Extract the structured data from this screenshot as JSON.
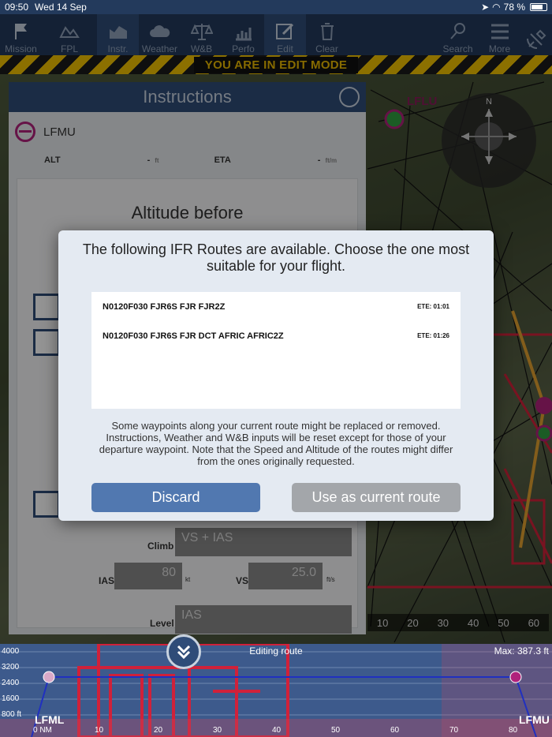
{
  "status": {
    "time": "09:50",
    "date": "Wed 14 Sep",
    "battery": "78 %",
    "battery_level": 0.78
  },
  "toolbar": {
    "items": [
      {
        "label": "Mission",
        "icon": "flag-icon"
      },
      {
        "label": "FPL",
        "icon": "map-icon"
      },
      {
        "label": "Instr.",
        "icon": "chart-area-icon"
      },
      {
        "label": "Weather",
        "icon": "cloud-icon"
      },
      {
        "label": "W&B",
        "icon": "scales-icon"
      },
      {
        "label": "Perfo",
        "icon": "bar-chart-icon"
      },
      {
        "label": "Edit",
        "icon": "edit-icon"
      },
      {
        "label": "Clear",
        "icon": "trash-icon"
      },
      {
        "label": "Search",
        "icon": "search-icon"
      },
      {
        "label": "More",
        "icon": "menu-icon"
      }
    ]
  },
  "banner": {
    "text": "YOU ARE IN EDIT MODE"
  },
  "instructions": {
    "title": "Instructions",
    "waypoint": "LFMU",
    "alt_label": "ALT",
    "alt_value": "-",
    "alt_unit": "ft",
    "eta_label": "ETA",
    "eta_value": "-",
    "eta_unit": "ft/m",
    "altitude_before": "Altitude before",
    "climb_label": "Climb",
    "climb_value": "VS + IAS",
    "ias_label": "IAS",
    "ias_value": "80",
    "ias_unit": "kt",
    "vs_label": "VS",
    "vs_value": "25.0",
    "vs_unit": "ft/s",
    "level_label": "Level",
    "level_value": "IAS"
  },
  "map": {
    "labels": [
      "LFLU"
    ],
    "scale": [
      "10",
      "20",
      "30",
      "40",
      "50",
      "60"
    ]
  },
  "profile": {
    "title": "Editing route",
    "max": "Max: 387.3 ft",
    "y_labels": [
      "4000",
      "3200",
      "2400",
      "1600",
      "800 ft"
    ],
    "start": "LFML",
    "end": "LFMU",
    "distance_ticks": [
      "0 NM",
      "10",
      "20",
      "30",
      "40",
      "50",
      "60",
      "70",
      "80"
    ]
  },
  "dialog": {
    "title": "The following IFR Routes are available. Choose the one most suitable for your flight.",
    "routes": [
      {
        "route": "N0120F030 FJR6S FJR FJR2Z",
        "ete": "ETE: 01:01"
      },
      {
        "route": "N0120F030 FJR6S FJR DCT AFRIC AFRIC2Z",
        "ete": "ETE: 01:26"
      }
    ],
    "note": "Some waypoints along your current route might be replaced or removed. Instructions, Weather and W&B inputs will be reset except for those of your departure waypoint. Note that the Speed and Altitude of the routes might differ from the ones originally requested.",
    "discard": "Discard",
    "use": "Use as current route"
  },
  "colors": {
    "toolbar": "#233a5c",
    "accent": "#5178b0",
    "route": "#d0213a",
    "waypoint": "#b0217b"
  }
}
